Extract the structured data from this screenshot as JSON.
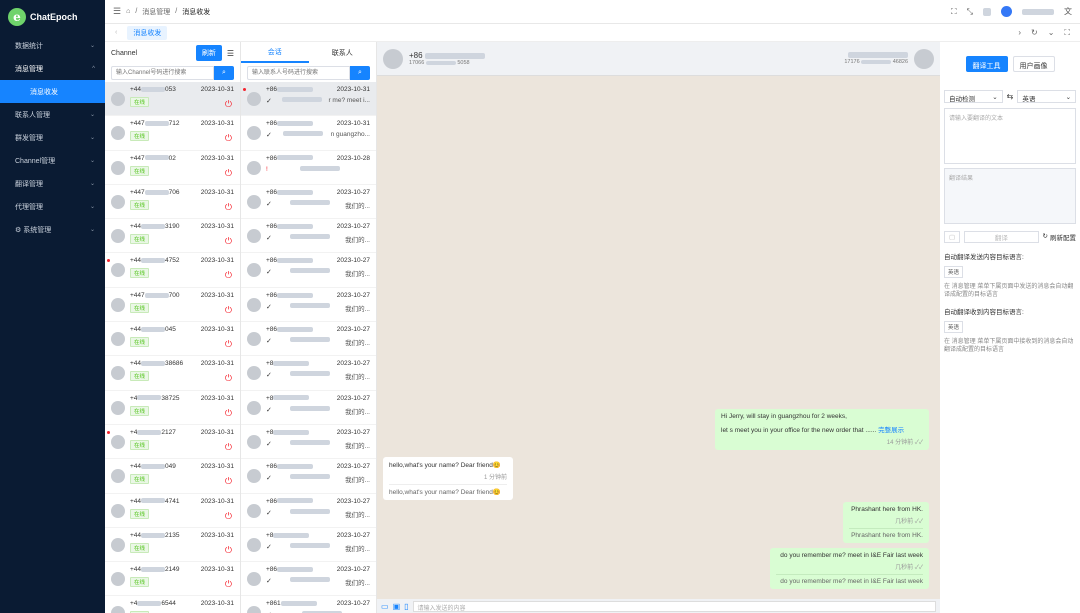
{
  "sidebar": {
    "brand": "ChatEpoch",
    "items": [
      {
        "label": "数据统计"
      },
      {
        "label": "消息管理"
      },
      {
        "label": "消息收发"
      },
      {
        "label": "联系人管理"
      },
      {
        "label": "群发管理"
      },
      {
        "label": "Channel管理"
      },
      {
        "label": "翻译管理"
      },
      {
        "label": "代理管理"
      },
      {
        "label": "系统管理"
      }
    ]
  },
  "breadcrumb": {
    "b1": "消息管理",
    "b2": "消息收发"
  },
  "tabs": {
    "active": "消息收发"
  },
  "channel": {
    "title": "Channel",
    "refresh": "刷新",
    "search_placeholder": "输入Channel号码进行搜索",
    "online_label": "在线",
    "rows": [
      {
        "num": "+44",
        "tail": "053",
        "date": "2023-10-31"
      },
      {
        "num": "+447",
        "tail": "712",
        "date": "2023-10-31"
      },
      {
        "num": "+447",
        "tail": "02",
        "date": "2023-10-31"
      },
      {
        "num": "+447",
        "tail": "706",
        "date": "2023-10-31"
      },
      {
        "num": "+44",
        "tail": "3190",
        "date": "2023-10-31"
      },
      {
        "num": "+44",
        "tail": "4752",
        "date": "2023-10-31"
      },
      {
        "num": "+447",
        "tail": "700",
        "date": "2023-10-31"
      },
      {
        "num": "+44",
        "tail": "045",
        "date": "2023-10-31"
      },
      {
        "num": "+44",
        "tail": "38686",
        "date": "2023-10-31"
      },
      {
        "num": "+4",
        "tail": "38725",
        "date": "2023-10-31"
      },
      {
        "num": "+4",
        "tail": "2127",
        "date": "2023-10-31"
      },
      {
        "num": "+44",
        "tail": "049",
        "date": "2023-10-31"
      },
      {
        "num": "+44",
        "tail": "4741",
        "date": "2023-10-31"
      },
      {
        "num": "+44",
        "tail": "2135",
        "date": "2023-10-31"
      },
      {
        "num": "+44",
        "tail": "2149",
        "date": "2023-10-31"
      },
      {
        "num": "+4",
        "tail": "6544",
        "date": "2023-10-31"
      }
    ]
  },
  "conversations": {
    "tab_session": "会话",
    "tab_contacts": "联系人",
    "search_placeholder": "输入联系人号码进行搜索",
    "rows": [
      {
        "num": "+86",
        "date": "2023-10-31",
        "msg": "r me? meet i..."
      },
      {
        "num": "+86",
        "date": "2023-10-31",
        "msg": "n guangzho..."
      },
      {
        "num": "+86",
        "date": "2023-10-28",
        "msg": ""
      },
      {
        "num": "+86",
        "date": "2023-10-27",
        "msg": "我们的..."
      },
      {
        "num": "+86",
        "date": "2023-10-27",
        "msg": "我们的..."
      },
      {
        "num": "+86",
        "date": "2023-10-27",
        "msg": "我们的..."
      },
      {
        "num": "+86",
        "date": "2023-10-27",
        "msg": "我们的..."
      },
      {
        "num": "+86",
        "date": "2023-10-27",
        "msg": "我们的..."
      },
      {
        "num": "+8",
        "date": "2023-10-27",
        "msg": "我们的..."
      },
      {
        "num": "+8",
        "date": "2023-10-27",
        "msg": "我们的..."
      },
      {
        "num": "+8",
        "date": "2023-10-27",
        "msg": "我们的..."
      },
      {
        "num": "+86",
        "date": "2023-10-27",
        "msg": "我们的..."
      },
      {
        "num": "+86",
        "date": "2023-10-27",
        "msg": "我们的..."
      },
      {
        "num": "+8",
        "date": "2023-10-27",
        "msg": "我们的..."
      },
      {
        "num": "+86",
        "date": "2023-10-27",
        "msg": "我们的..."
      },
      {
        "num": "+861",
        "date": "2023-10-27",
        "msg": ""
      }
    ]
  },
  "chat": {
    "contact": "+86",
    "contact_sub": "17066",
    "contact_sub2": "5058",
    "self_sub": "17176",
    "self_sub2": "46826",
    "messages": {
      "m1_line1": "Hi Jerry, will stay in guangzhou for 2 weeks,",
      "m1_line2": "let s meet you in your office for the new order that ......",
      "m1_more": "完整展示",
      "m1_time": "14 分钟前",
      "m2_text": "hello,what's your name? Dear friend😊",
      "m2_time": "1 分钟前",
      "m2_trans": "hello,what's your name? Dear friend😊",
      "m3_text": "Phrashant here from HK.",
      "m3_time": "几秒前",
      "m3_trans": "Phrashant here from HK.",
      "m4_text": "do you remember me? meet in I&E Fair last week",
      "m4_time": "几秒前",
      "m4_trans": "do you remember me? meet in I&E Fair last week"
    },
    "input_placeholder": "请输入发送的内容"
  },
  "translator": {
    "tab_tool": "翻译工具",
    "tab_profile": "用户画像",
    "src_lang": "自动检测",
    "dst_lang": "英语",
    "src_placeholder": "请输入要翻译的文本",
    "result_placeholder": "翻译结果",
    "translate_btn": "翻译",
    "refresh_config": "刷新配置",
    "send_label": "自动翻译发送内容目标语言:",
    "send_lang": "英语",
    "send_note": "在 消息管理 菜单下属页面中发送的消息会自动翻译成配置的目标语言",
    "recv_label": "自动翻译收到内容目标语言:",
    "recv_lang": "英语",
    "recv_note": "在 消息管理 菜单下属页面中接收到的消息会自动翻译成配置的目标语言"
  }
}
